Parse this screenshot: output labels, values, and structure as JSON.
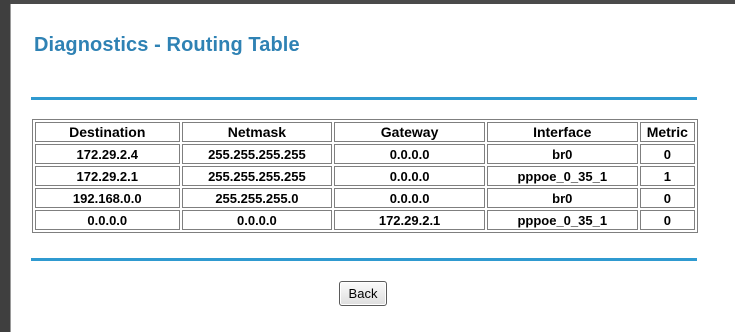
{
  "page": {
    "title": "Diagnostics - Routing Table"
  },
  "routing_table": {
    "headers": [
      "Destination",
      "Netmask",
      "Gateway",
      "Interface",
      "Metric"
    ],
    "rows": [
      [
        "172.29.2.4",
        "255.255.255.255",
        "0.0.0.0",
        "br0",
        "0"
      ],
      [
        "172.29.2.1",
        "255.255.255.255",
        "0.0.0.0",
        "pppoe_0_35_1",
        "1"
      ],
      [
        "192.168.0.0",
        "255.255.255.0",
        "0.0.0.0",
        "br0",
        "0"
      ],
      [
        "0.0.0.0",
        "0.0.0.0",
        "172.29.2.1",
        "pppoe_0_35_1",
        "0"
      ]
    ]
  },
  "actions": {
    "back_label": "Back"
  },
  "colors": {
    "title": "#2f82b4",
    "rule": "#2f9ad0"
  }
}
